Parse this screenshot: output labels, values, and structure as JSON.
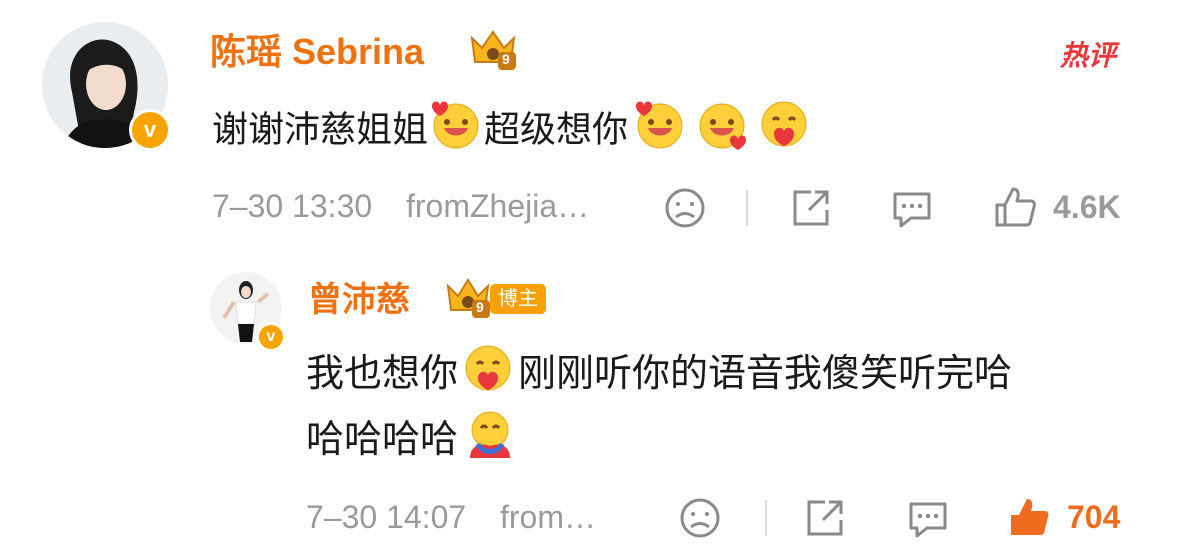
{
  "colors": {
    "username": "#ef7212",
    "meta": "#9a9a9a",
    "like_active": "#ef6b1e",
    "hot": "#e8383d",
    "badge": "#f7a400"
  },
  "comment": {
    "username": "陈瑶 Sebrina",
    "badge_level": "9",
    "hot_label": "热评",
    "verified_badge": "v",
    "text_segments": [
      "谢谢沛慈姐姐",
      "超级想你"
    ],
    "timestamp": "7–30 13:30",
    "location": "fromZhejia…",
    "like_count": "4.6K",
    "icons": [
      "dislike-icon",
      "share-icon",
      "reply-icon",
      "like-icon"
    ]
  },
  "reply": {
    "username": "曾沛慈",
    "badge_level": "9",
    "role_tag": "博主",
    "verified_badge": "v",
    "text_line1": [
      "我也想你",
      "刚刚听你的语音我傻笑听完哈"
    ],
    "text_line2": "哈哈哈哈",
    "timestamp": "7–30 14:07",
    "location": "from…",
    "like_count": "704",
    "icons": [
      "dislike-icon",
      "share-icon",
      "reply-icon",
      "like-icon"
    ]
  }
}
